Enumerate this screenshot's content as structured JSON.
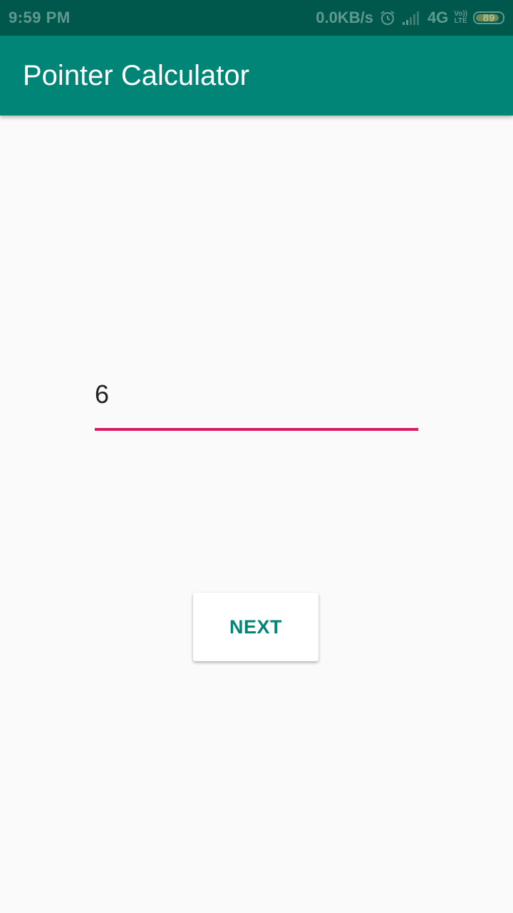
{
  "status_bar": {
    "time": "9:59 PM",
    "net_speed": "0.0KB/s",
    "network_type": "4G",
    "volte_top": "Vo))",
    "volte_bottom": "LTE",
    "battery_level": "89",
    "battery_fraction": 0.89,
    "icons": [
      "alarm-icon",
      "signal-icon",
      "battery-icon"
    ]
  },
  "app_bar": {
    "title": "Pointer Calculator",
    "color": "#008577"
  },
  "number_field": {
    "value": "6",
    "underline_color": "#d81b60"
  },
  "next_button": {
    "label": "NEXT",
    "color": "#008577"
  }
}
